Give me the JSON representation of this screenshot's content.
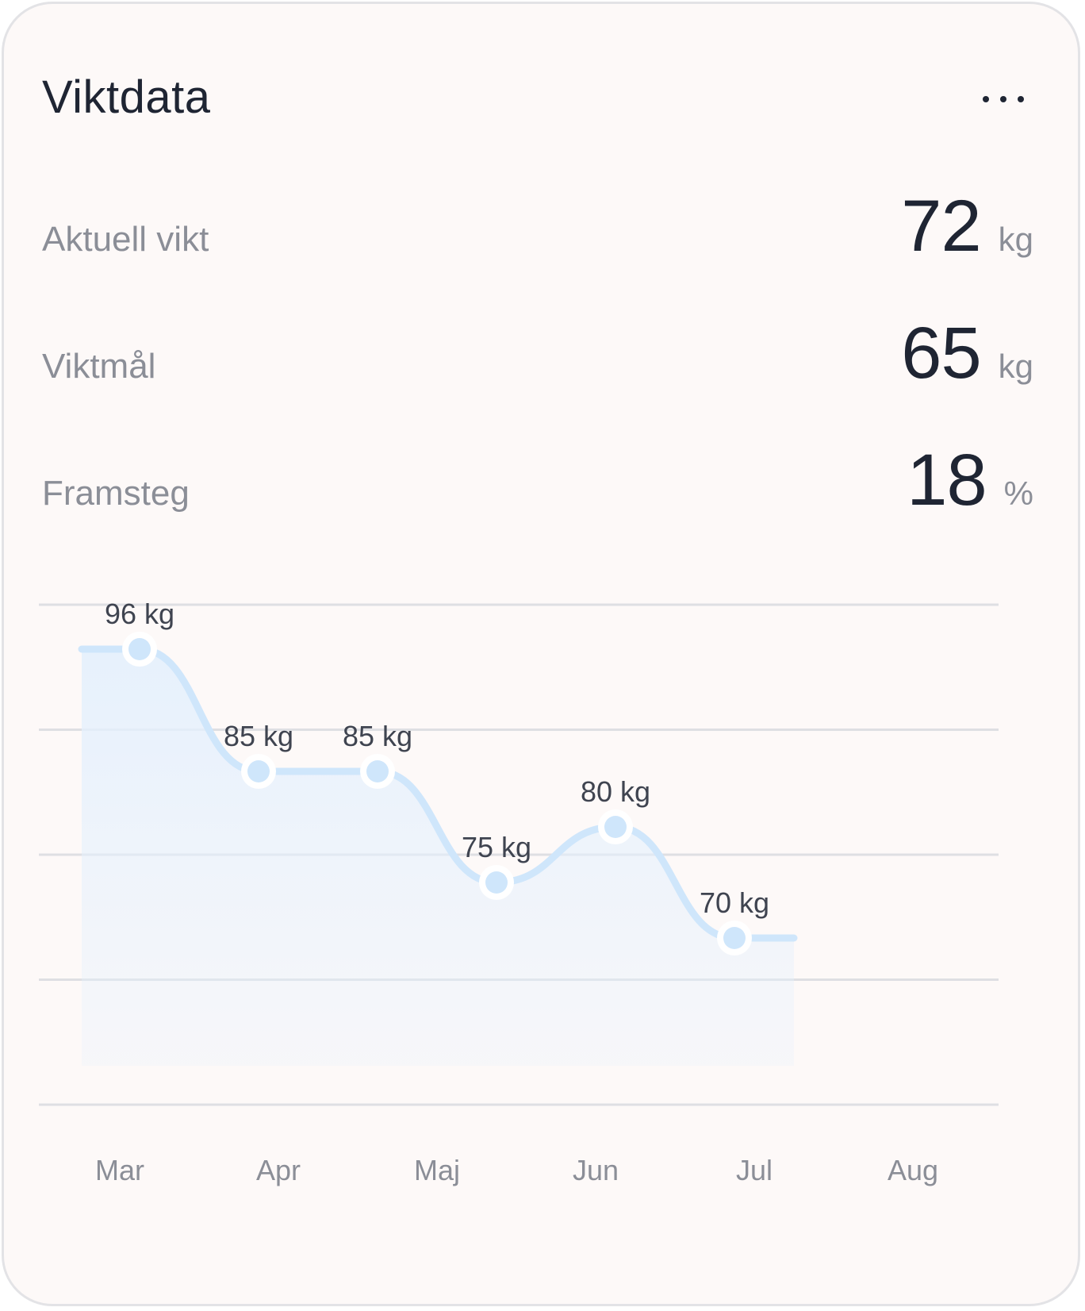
{
  "card": {
    "title": "Viktdata",
    "menu_icon": "more-horizontal-icon"
  },
  "stats": [
    {
      "label": "Aktuell vikt",
      "value": "72",
      "unit": "kg"
    },
    {
      "label": "Viktmål",
      "value": "65",
      "unit": "kg"
    },
    {
      "label": "Framsteg",
      "value": "18",
      "unit": "%"
    }
  ],
  "colors": {
    "line": "#cfe6fb",
    "point": "#cfe6fb",
    "area_top": "#e4f0fd",
    "grid": "#dedfe3",
    "label": "#3f4450",
    "axis_label": "#8b8e97"
  },
  "chart_data": {
    "type": "area",
    "x_categories": [
      "Mar",
      "Apr",
      "Maj",
      "Jun",
      "Jul",
      "Aug"
    ],
    "x": [
      0.125,
      0.875,
      1.625,
      2.375,
      3.125,
      3.875
    ],
    "values": [
      96,
      85,
      85,
      75,
      80,
      70
    ],
    "point_labels": [
      "96 kg",
      "85 kg",
      "85 kg",
      "75 kg",
      "80 kg",
      "70 kg"
    ],
    "unit": "kg",
    "line_extends_from": -0.25,
    "line_extends_to": 4.25,
    "ylim": [
      55,
      100
    ],
    "gridlines": 5,
    "title": "",
    "xlabel": "",
    "ylabel": "",
    "grid": true,
    "legend": "none"
  }
}
